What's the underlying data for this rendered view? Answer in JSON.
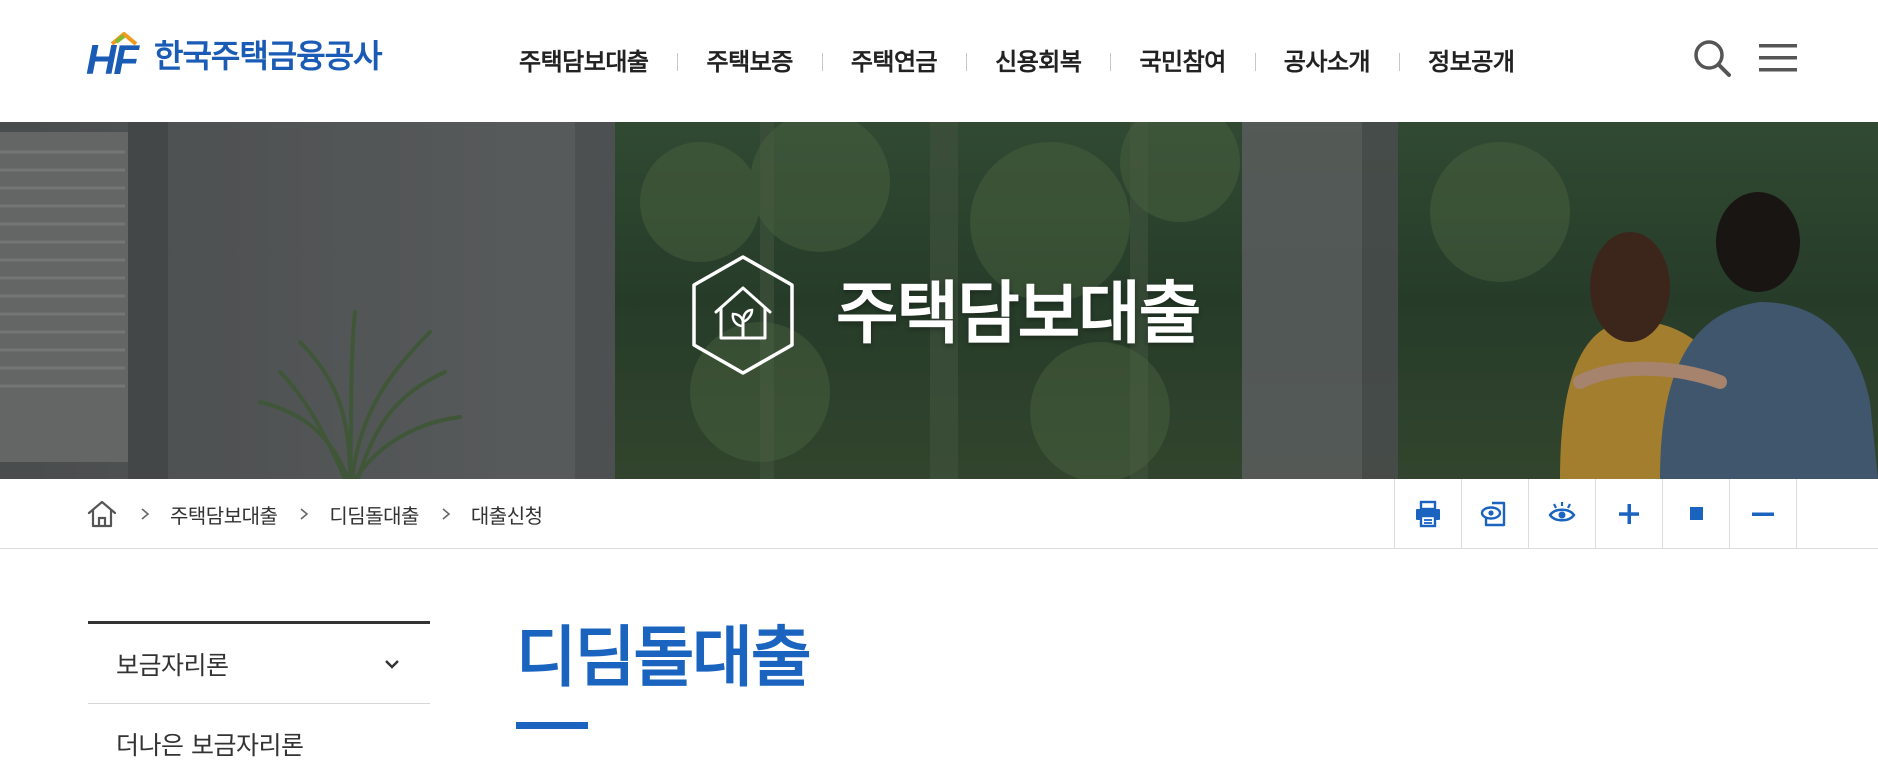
{
  "header": {
    "logo_mark": "HF",
    "logo_name": "한국주택금융공사",
    "nav": [
      {
        "label": "주택담보대출"
      },
      {
        "label": "주택보증"
      },
      {
        "label": "주택연금"
      },
      {
        "label": "신용회복"
      },
      {
        "label": "국민참여"
      },
      {
        "label": "공사소개"
      },
      {
        "label": "정보공개"
      }
    ],
    "icons": [
      "search-icon",
      "menu-icon"
    ]
  },
  "hero": {
    "title": "주택담보대출",
    "emblem_icon": "house-sprout-icon"
  },
  "breadcrumb": {
    "home_icon": "home-icon",
    "items": [
      "주택담보대출",
      "디딤돌대출",
      "대출신청"
    ]
  },
  "tools": [
    "print-icon",
    "page-view-icon",
    "eye-icon",
    "zoom-in-icon",
    "reset-icon",
    "zoom-out-icon"
  ],
  "sidebar": {
    "items": [
      {
        "label": "보금자리론",
        "expandable": true
      },
      {
        "label": "더나은 보금자리론",
        "expandable": false
      }
    ]
  },
  "main": {
    "title": "디딤돌대출"
  },
  "colors": {
    "brand": "#1a5bb5",
    "accent": "#1a64c0",
    "text": "#222222",
    "divider": "#dcdcdc"
  }
}
